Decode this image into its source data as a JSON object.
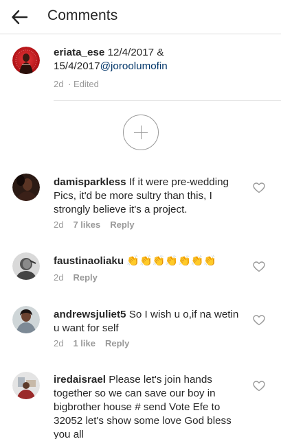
{
  "header": {
    "title": "Comments"
  },
  "caption": {
    "username": "eriata_ese",
    "text_line1": "12/4/2017 &",
    "text_line2": "15/4/2017",
    "mention": "@joroolumofin",
    "time": "2d",
    "edited": "· Edited"
  },
  "comments": [
    {
      "username": "damisparkless",
      "text_line1": "If it were pre-wedding",
      "text_line2": "Pics, it'd be more sultry than this, I",
      "text_line3": "strongly believe it's a project.",
      "time": "2d",
      "likes": "7 likes",
      "reply": "Reply"
    },
    {
      "username": "faustinaoliaku",
      "text": "👏👏👏👏👏👏👏",
      "time": "2d",
      "reply": "Reply"
    },
    {
      "username": "andrewsjuliet5",
      "text_line1": "So I wish u o,if na wetin",
      "text_line2": "u want for self",
      "time": "2d",
      "likes": "1 like",
      "reply": "Reply"
    },
    {
      "username": "iredaisrael",
      "text_line1": "Please let's join hands",
      "text_line2": "together so we can save our boy in",
      "text_line3": "bigbrother house # send Vote Efe to",
      "text_line4": "32052 let's show some love God bless",
      "text_line5": "you all"
    }
  ],
  "icons": {
    "back": "arrow-left-icon",
    "load_more": "plus-circle-icon",
    "like": "heart-outline-icon"
  },
  "colors": {
    "text": "#262626",
    "meta": "#999999",
    "mention": "#003569",
    "divider": "#dbdbdb"
  }
}
